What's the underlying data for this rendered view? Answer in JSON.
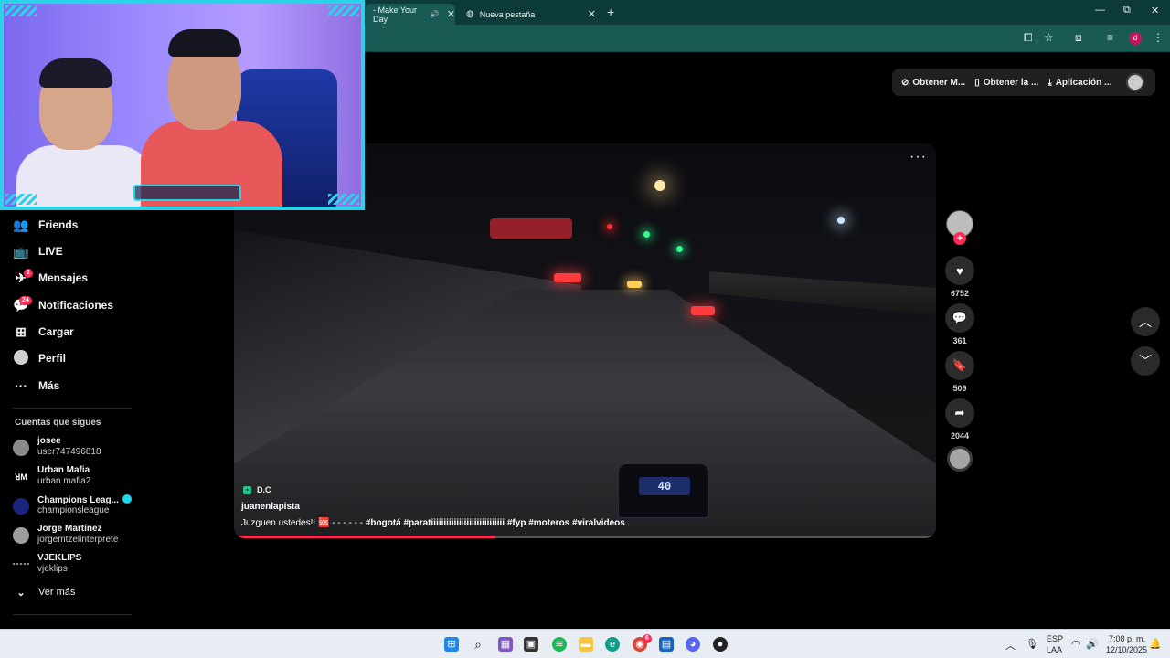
{
  "browser": {
    "tabs": [
      {
        "label": "- Make Your Day",
        "active": true
      },
      {
        "label": "Nueva pestaña",
        "active": false
      }
    ],
    "new_tab": "+",
    "window_controls": {
      "minimize": "—",
      "restore": "⧉",
      "close": "✕"
    },
    "profile_initial": "d"
  },
  "header": {
    "items": [
      {
        "icon": "coin-icon",
        "label": "Obtener M..."
      },
      {
        "icon": "phone-icon",
        "label": "Obtener la ..."
      },
      {
        "icon": "download-icon",
        "label": "Aplicación ..."
      }
    ]
  },
  "sidebar": {
    "items": [
      {
        "icon": "friends-icon",
        "label": "Friends"
      },
      {
        "icon": "live-icon",
        "label": "LIVE"
      },
      {
        "icon": "messages-icon",
        "label": "Mensajes",
        "badge": "2"
      },
      {
        "icon": "notifications-icon",
        "label": "Notificaciones",
        "badge": "24"
      },
      {
        "icon": "upload-icon",
        "label": "Cargar"
      },
      {
        "icon": "profile-icon",
        "label": "Perfil"
      },
      {
        "icon": "more-icon",
        "label": "Más"
      }
    ],
    "following_title": "Cuentas que sigues",
    "following": [
      {
        "name": "josee",
        "username": "user747496818",
        "verified": false
      },
      {
        "name": "Urban Mafia",
        "username": "urban.mafia2",
        "verified": false
      },
      {
        "name": "Champions Leag...",
        "username": "championsleague",
        "verified": true
      },
      {
        "name": "Jorge Martínez",
        "username": "jorgemtzelinterprete",
        "verified": false
      },
      {
        "name": "VJEKLIPS",
        "username": "vjeklips",
        "verified": false
      }
    ],
    "see_more": "Ver más"
  },
  "video": {
    "speedometer": "40",
    "tag_label": "D.C",
    "author": "juanenlapista",
    "description": "Juzguen ustedes!! 🆘 - - - - - - ",
    "hashtags": [
      "#bogotá",
      "#paratiiiiiiiiiiiiiiiiiiiiiiiiiiiii",
      "#fyp",
      "#moteros",
      "#viralvideos"
    ],
    "progress": 0.37
  },
  "actions": {
    "likes": "6752",
    "comments": "361",
    "saves": "509",
    "shares": "2044"
  },
  "taskbar": {
    "lang_top": "ESP",
    "lang_bottom": "LAA",
    "time": "7:08 p. m.",
    "date": "12/10/2025",
    "chrome_badge": "6"
  },
  "colors": {
    "accent": "#fe2c55",
    "chrome_bg": "#1a5a55",
    "webcam_frame": "#2ad3e8"
  }
}
